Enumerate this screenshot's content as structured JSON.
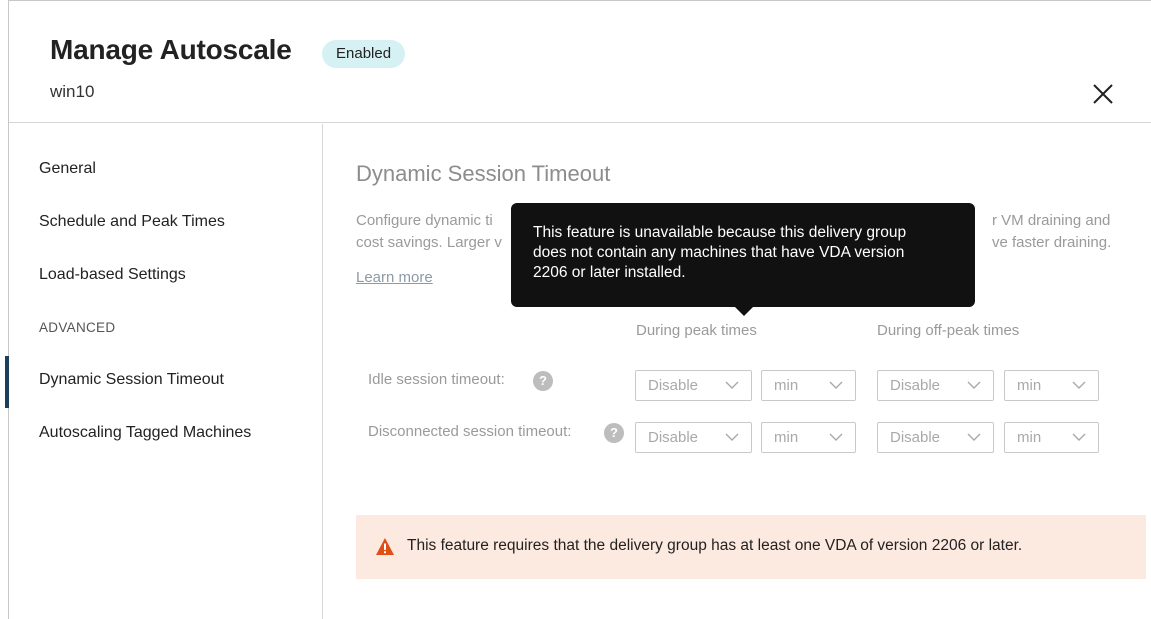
{
  "header": {
    "title": "Manage Autoscale",
    "badge": "Enabled",
    "subtitle": "win10"
  },
  "sidebar": {
    "items": [
      {
        "label": "General"
      },
      {
        "label": "Schedule and Peak Times"
      },
      {
        "label": "Load-based Settings"
      }
    ],
    "advanced_heading": "ADVANCED",
    "advanced_items": [
      {
        "label": "Dynamic Session Timeout",
        "active": true
      },
      {
        "label": "Autoscaling Tagged Machines"
      }
    ]
  },
  "main": {
    "title": "Dynamic Session Timeout",
    "desc_left_line1": "Configure dynamic ti",
    "desc_left_line2": "cost savings. Larger v",
    "desc_right_line1": "r VM draining and",
    "desc_right_line2": "ve faster draining.",
    "learn_more": "Learn more",
    "columns": {
      "peak": "During peak times",
      "offpeak": "During off-peak times"
    },
    "rows": [
      {
        "label": "Idle session timeout:",
        "peak_value": "Disable",
        "peak_unit": "min",
        "offpeak_value": "Disable",
        "offpeak_unit": "min"
      },
      {
        "label": "Disconnected session timeout:",
        "peak_value": "Disable",
        "peak_unit": "min",
        "offpeak_value": "Disable",
        "offpeak_unit": "min"
      }
    ],
    "help_glyph": "?"
  },
  "tooltip": {
    "line1": "This feature is unavailable because this delivery group",
    "line2": "does not contain any machines that have VDA version",
    "line3": "2206 or later installed."
  },
  "warning": {
    "text": "This feature requires that the delivery group has at least one VDA of version 2206 or later.",
    "icon": "warning-triangle-icon",
    "color": "#e04f16"
  },
  "colors": {
    "badge_bg": "#d6f1f3",
    "active_indicator": "#1d3f5a",
    "warning_bg": "#fce9df",
    "tooltip_bg": "#111111"
  }
}
